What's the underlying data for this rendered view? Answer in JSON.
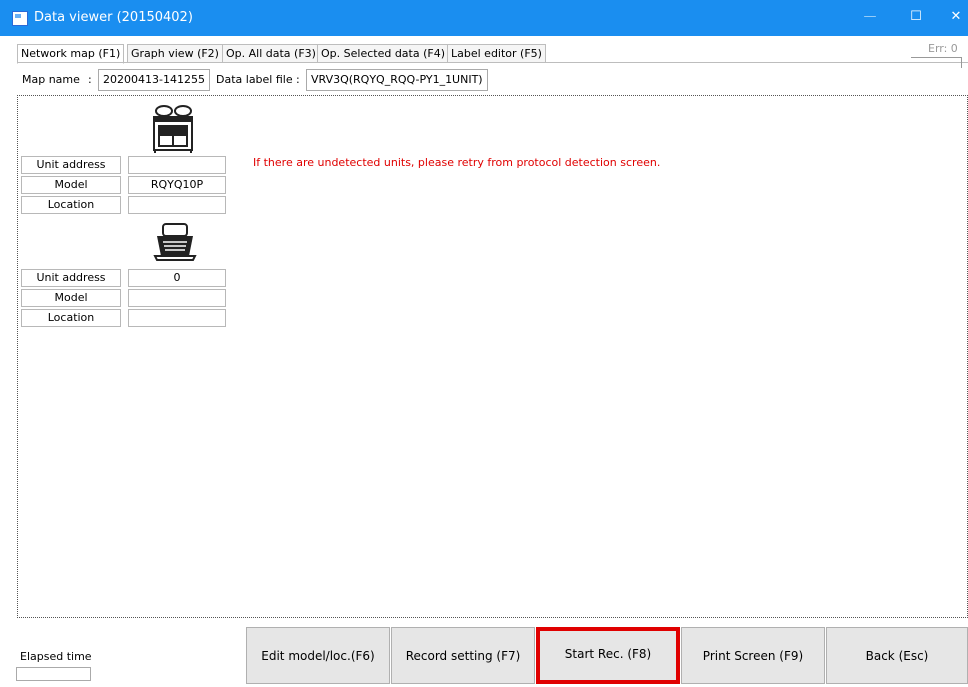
{
  "window": {
    "title": "Data viewer (20150402)",
    "minimize": "—",
    "maximize": "☐",
    "close": "✕"
  },
  "tabs": [
    {
      "label": "Network map (F1)",
      "active": true
    },
    {
      "label": "Graph view (F2)",
      "active": false
    },
    {
      "label": "Op. All data (F3)",
      "active": false
    },
    {
      "label": "Op. Selected data (F4)",
      "active": false
    },
    {
      "label": "Label editor (F5)",
      "active": false
    }
  ],
  "err_label": "Err: 0",
  "map_name": {
    "label": "Map name",
    "sep": ":",
    "value": "20200413-141255"
  },
  "data_label_file": {
    "label": "Data label file",
    "sep": ":",
    "value": "VRV3Q(RQYQ_RQQ-PY1_1UNIT)"
  },
  "units": [
    {
      "icon": "outdoor-unit-icon",
      "rows": [
        {
          "label": "Unit address",
          "value": ""
        },
        {
          "label": "Model",
          "value": "RQYQ10P"
        },
        {
          "label": "Location",
          "value": ""
        }
      ]
    },
    {
      "icon": "indoor-cassette-unit-icon",
      "rows": [
        {
          "label": "Unit address",
          "value": "0"
        },
        {
          "label": "Model",
          "value": ""
        },
        {
          "label": "Location",
          "value": ""
        }
      ]
    }
  ],
  "notice": "If there are undetected units, please retry from protocol detection screen.",
  "colors": {
    "titlebar": "#1a8ef0",
    "notice": "#e00000",
    "highlight": "#e00000"
  },
  "footer": {
    "elapsed_label": "Elapsed time",
    "elapsed_value": "",
    "buttons": [
      {
        "label": "Edit model/loc.(F6)"
      },
      {
        "label": "Record setting (F7)"
      },
      {
        "label": "Start Rec. (F8)",
        "highlighted": true
      },
      {
        "label": "Print Screen (F9)"
      },
      {
        "label": "Back (Esc)"
      }
    ]
  }
}
